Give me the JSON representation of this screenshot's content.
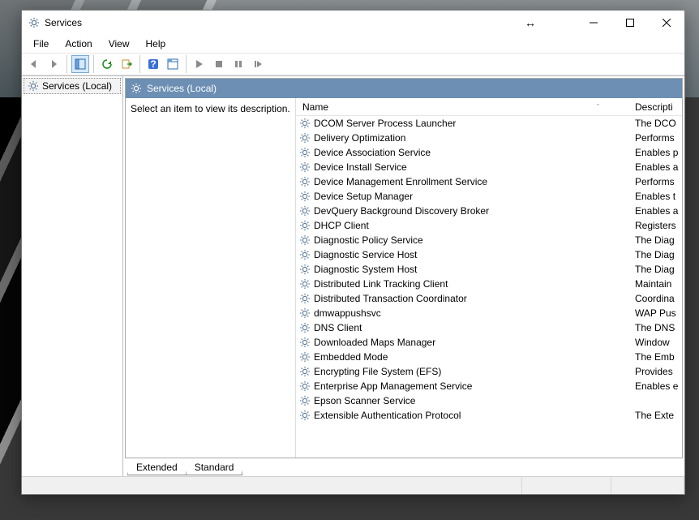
{
  "window": {
    "title": "Services"
  },
  "menu": {
    "file": "File",
    "action": "Action",
    "view": "View",
    "help": "Help"
  },
  "tree": {
    "root": "Services (Local)"
  },
  "detail": {
    "header": "Services (Local)",
    "description_prompt": "Select an item to view its description.",
    "columns": {
      "name": "Name",
      "description": "Descripti"
    }
  },
  "tabs": {
    "extended": "Extended",
    "standard": "Standard"
  },
  "services": [
    {
      "name": "DCOM Server Process Launcher",
      "desc": "The DCO"
    },
    {
      "name": "Delivery Optimization",
      "desc": "Performs"
    },
    {
      "name": "Device Association Service",
      "desc": "Enables p"
    },
    {
      "name": "Device Install Service",
      "desc": "Enables a"
    },
    {
      "name": "Device Management Enrollment Service",
      "desc": "Performs"
    },
    {
      "name": "Device Setup Manager",
      "desc": "Enables t"
    },
    {
      "name": "DevQuery Background Discovery Broker",
      "desc": "Enables a"
    },
    {
      "name": "DHCP Client",
      "desc": "Registers"
    },
    {
      "name": "Diagnostic Policy Service",
      "desc": "The Diag"
    },
    {
      "name": "Diagnostic Service Host",
      "desc": "The Diag"
    },
    {
      "name": "Diagnostic System Host",
      "desc": "The Diag"
    },
    {
      "name": "Distributed Link Tracking Client",
      "desc": "Maintain"
    },
    {
      "name": "Distributed Transaction Coordinator",
      "desc": "Coordina"
    },
    {
      "name": "dmwappushsvc",
      "desc": "WAP Pus"
    },
    {
      "name": "DNS Client",
      "desc": "The DNS"
    },
    {
      "name": "Downloaded Maps Manager",
      "desc": "Window"
    },
    {
      "name": "Embedded Mode",
      "desc": "The Emb"
    },
    {
      "name": "Encrypting File System (EFS)",
      "desc": "Provides"
    },
    {
      "name": "Enterprise App Management Service",
      "desc": "Enables e"
    },
    {
      "name": "Epson Scanner Service",
      "desc": ""
    },
    {
      "name": "Extensible Authentication Protocol",
      "desc": "The Exte"
    }
  ]
}
